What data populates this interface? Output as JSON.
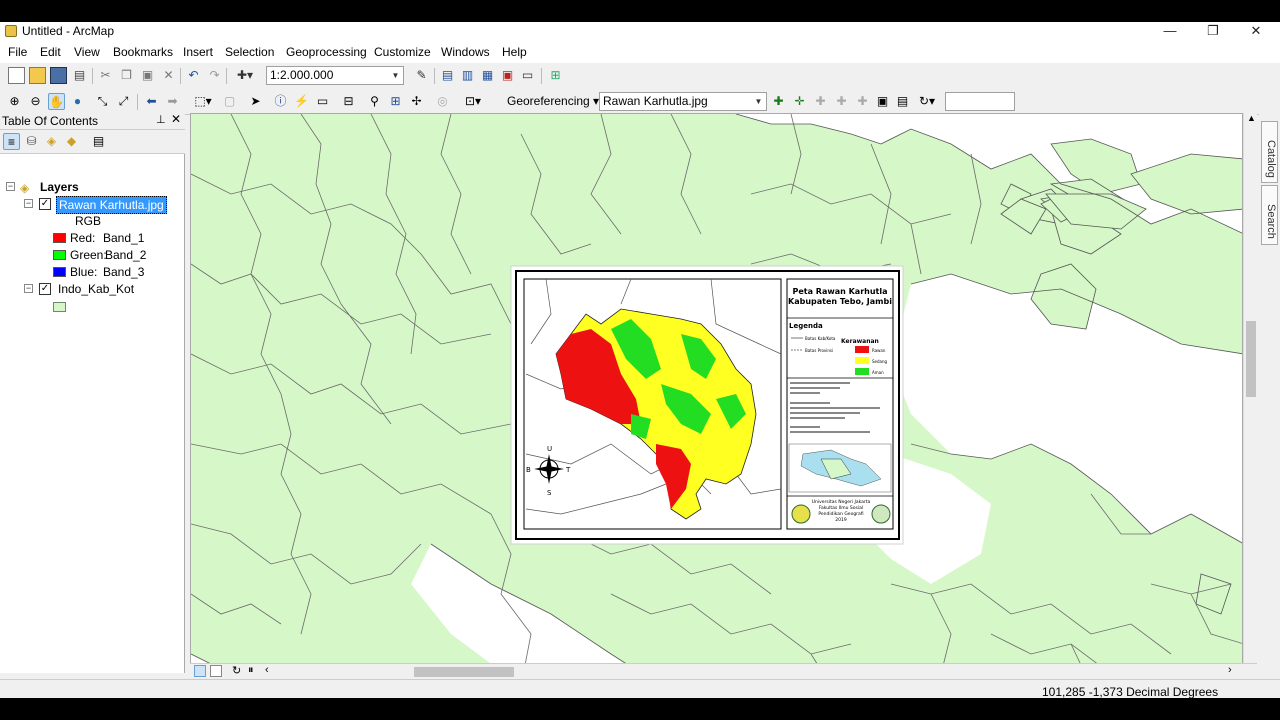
{
  "window": {
    "title": "Untitled - ArcMap",
    "minimize": "—",
    "maximize": "❐",
    "close": "✕"
  },
  "menu": [
    "File",
    "Edit",
    "View",
    "Bookmarks",
    "Insert",
    "Selection",
    "Geoprocessing",
    "Customize",
    "Windows",
    "Help"
  ],
  "toolbar": {
    "scale_value": "1:2.000.000",
    "georef_label": "Georeferencing",
    "georef_layer": "Rawan Karhutla.jpg",
    "georef_box": ""
  },
  "toc": {
    "title": "Table Of Contents",
    "layers_label": "Layers",
    "raster_layer": "Rawan Karhutla.jpg",
    "rgb_label": "RGB",
    "bands": [
      {
        "channel": "Red:",
        "band": "Band_1",
        "color": "#ff0000"
      },
      {
        "channel": "Green:",
        "band": "Band_2",
        "color": "#00ff00"
      },
      {
        "channel": "Blue:",
        "band": "Band_3",
        "color": "#0000ff"
      }
    ],
    "vector_layer": "Indo_Kab_Kot",
    "vector_fill": "#d6f5c8"
  },
  "map": {
    "land_color": "#d6f7c8",
    "sea_color": "#ffffff",
    "inset": {
      "title1": "Peta Rawan Karhutla",
      "title2": "Kabupaten Tebo, Jambi",
      "legend_title": "Legenda",
      "kerawanan": "Kerawanan",
      "classes": [
        {
          "label": "Rawan",
          "color": "#ee1111"
        },
        {
          "label": "Sedang",
          "color": "#ffff22"
        },
        {
          "label": "Aman",
          "color": "#22dd22"
        }
      ],
      "line_labels": [
        "Batas Kab/Kota",
        "Batas Provinsi"
      ],
      "org1": "Universitas Negeri Jakarta",
      "org2": "Fakultas Ilmu Sosial",
      "org3": "Pendidikan Geografi",
      "year": "2019",
      "north": "U",
      "south": "S",
      "west": "B",
      "east": "T"
    }
  },
  "dock": {
    "catalog": "Catalog",
    "search": "Search"
  },
  "status": {
    "coords": "101,285  -1,373 Decimal Degrees"
  }
}
